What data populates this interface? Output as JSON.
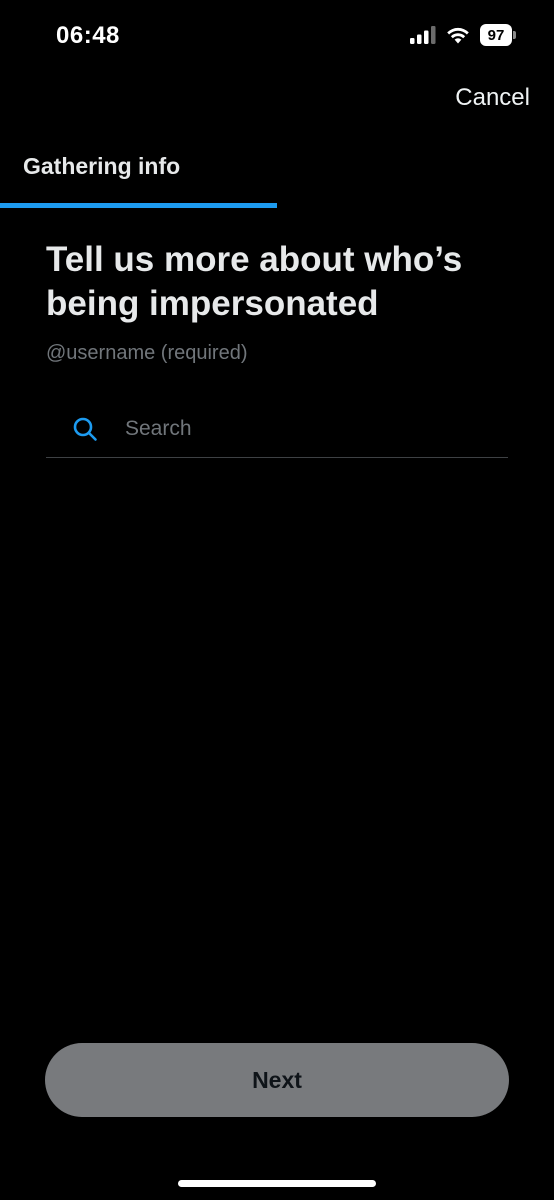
{
  "status_bar": {
    "time": "06:48",
    "battery": "97"
  },
  "header": {
    "cancel_label": "Cancel",
    "step_title": "Gathering info",
    "progress": 0.5
  },
  "main": {
    "heading": "Tell us more about who’s being impersonated",
    "sub_label": "@username (required)"
  },
  "search": {
    "value": "",
    "placeholder": "Search",
    "icon": "search-icon"
  },
  "footer": {
    "next_label": "Next"
  },
  "colors": {
    "accent": "#1d9bf0",
    "background": "#000000",
    "muted_text": "#71767b",
    "button_disabled": "#787a7d"
  }
}
